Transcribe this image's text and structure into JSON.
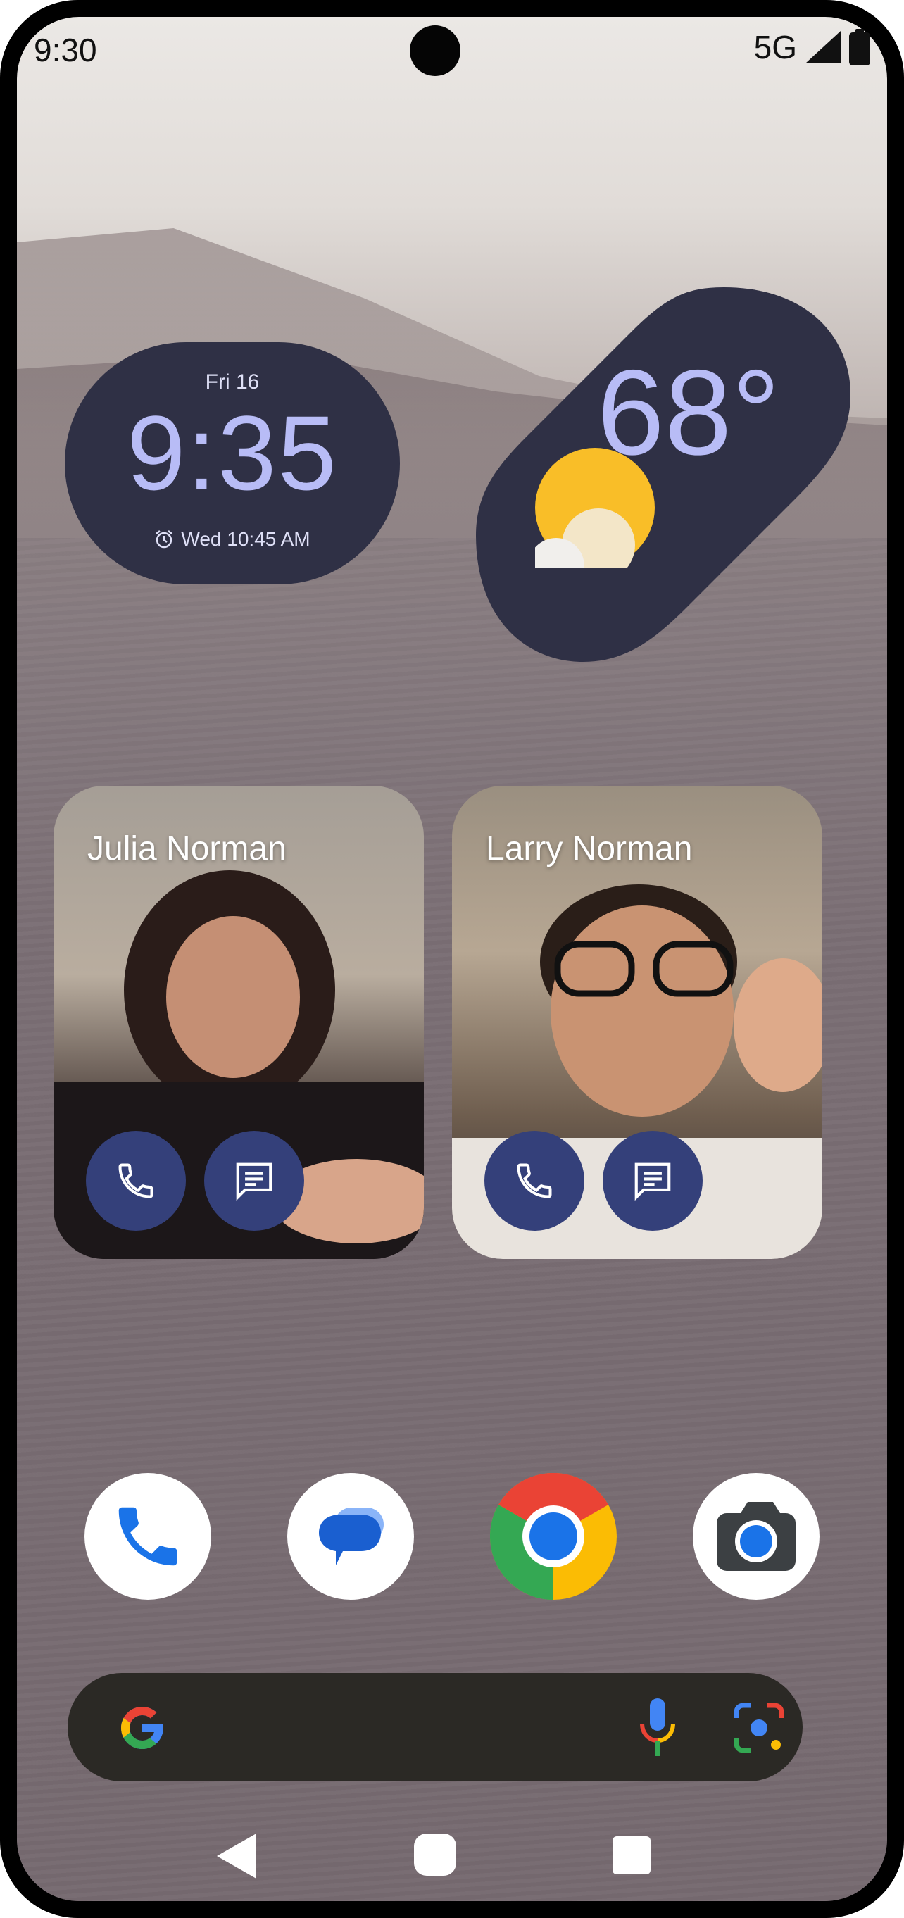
{
  "status_bar": {
    "time": "9:30",
    "network": "5G",
    "icons": [
      "signal-icon",
      "battery-icon"
    ]
  },
  "clock_widget": {
    "date": "Fri 16",
    "time": "9:35",
    "alarm": "Wed 10:45 AM",
    "alarm_icon": "alarm-icon"
  },
  "weather_widget": {
    "temperature": "68°",
    "condition_icon": "partly-sunny-icon"
  },
  "contacts": [
    {
      "name": "Julia Norman",
      "actions": [
        "phone-icon",
        "message-icon"
      ]
    },
    {
      "name": "Larry Norman",
      "actions": [
        "phone-icon",
        "message-icon"
      ]
    }
  ],
  "dock": {
    "apps": [
      "phone-app-icon",
      "messages-app-icon",
      "chrome-app-icon",
      "camera-app-icon"
    ]
  },
  "search_bar": {
    "icons": [
      "google-g-icon",
      "mic-icon",
      "lens-icon"
    ]
  },
  "navigation": {
    "icons": [
      "back-icon",
      "home-icon",
      "recents-icon"
    ]
  },
  "colors": {
    "widget_bg": "#2f3045",
    "widget_accent": "#b8bcf6",
    "contact_button": "#34407a",
    "search_bar_bg": "#2b2925"
  }
}
